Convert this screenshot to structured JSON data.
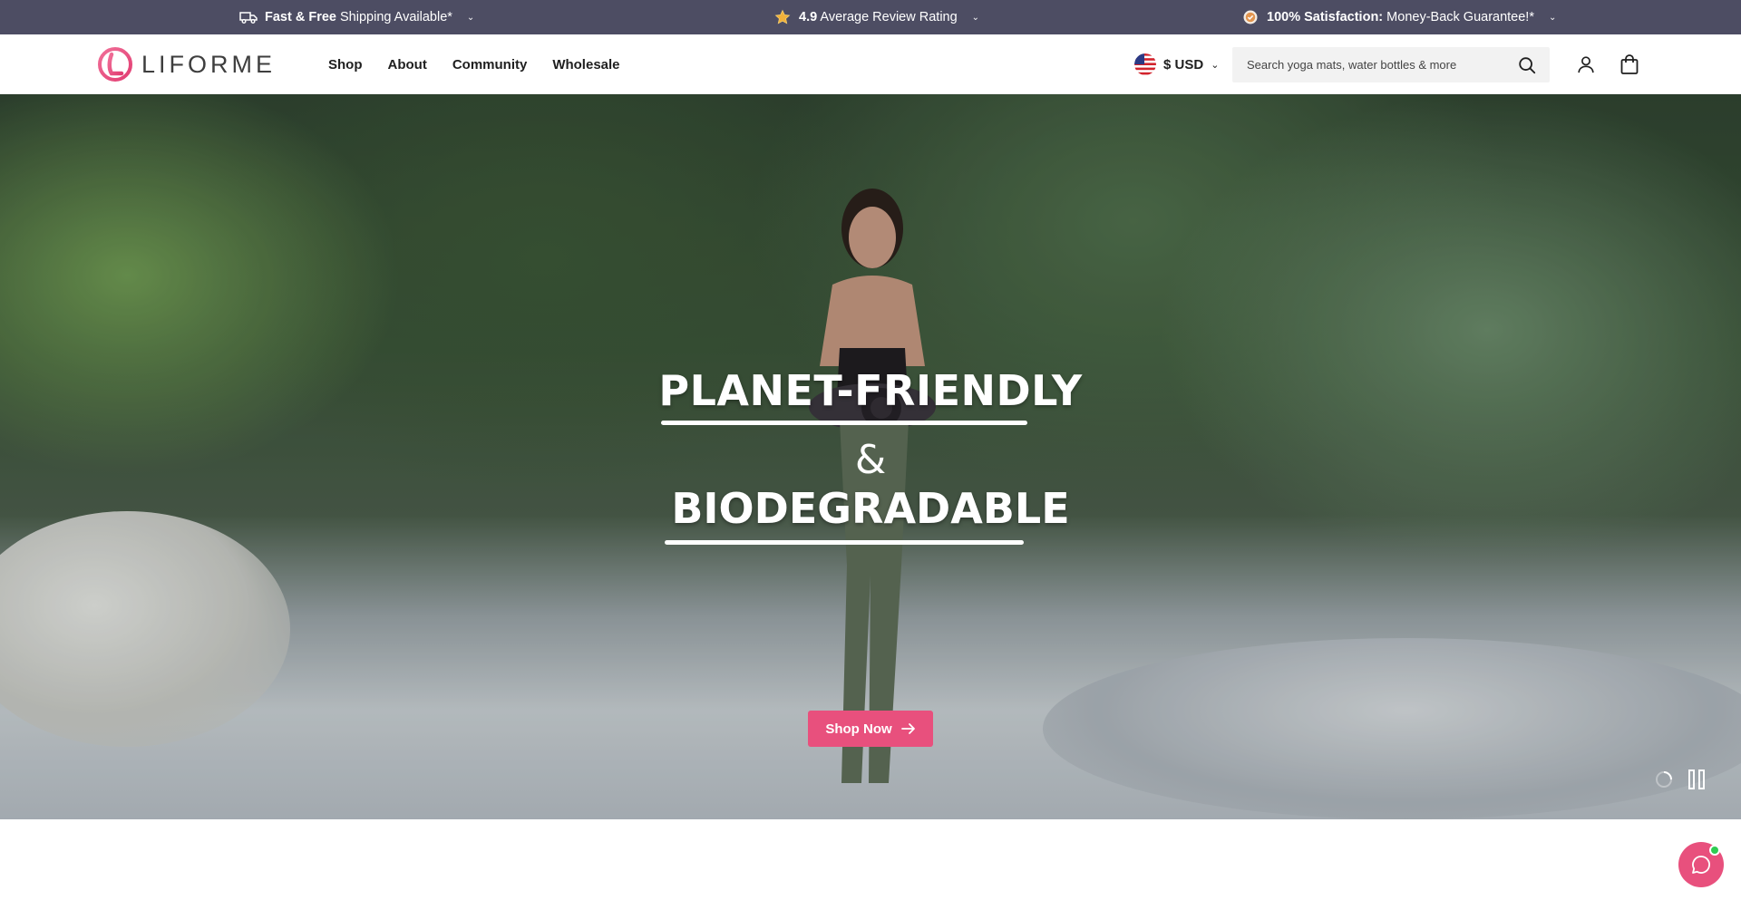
{
  "announcements": [
    {
      "icon": "truck-icon",
      "strong": "Fast & Free",
      "text": "Shipping Available*"
    },
    {
      "icon": "star-icon",
      "strong": "4.9",
      "text": "Average Review Rating"
    },
    {
      "icon": "badge-check-icon",
      "strong": "100% Satisfaction:",
      "text": "Money-Back Guarantee!*"
    }
  ],
  "header": {
    "logo_text": "LIFORME",
    "nav": [
      "Shop",
      "About",
      "Community",
      "Wholesale"
    ],
    "currency": "$ USD",
    "search_placeholder": "Search yoga mats, water bottles & more"
  },
  "hero": {
    "headline_1": "PLANET-FRIENDLY",
    "ampersand": "&",
    "headline_2": "BIODEGRADABLE",
    "cta_label": "Shop Now"
  },
  "colors": {
    "announcement_bg": "#4d4d63",
    "accent": "#e8507d",
    "text": "#1f1f1f"
  },
  "icons": [
    "truck-icon",
    "star-icon",
    "badge-check-icon",
    "chevron-down-icon",
    "us-flag-icon",
    "search-icon",
    "account-icon",
    "shopping-bag-icon",
    "arrow-right-icon",
    "loading-icon",
    "pause-icon",
    "chat-icon"
  ]
}
